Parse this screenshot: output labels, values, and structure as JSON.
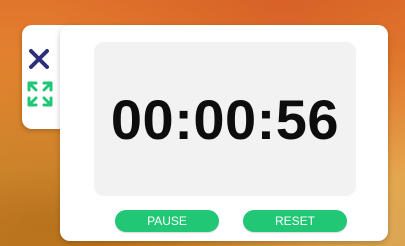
{
  "timer": {
    "display": "00:00:56"
  },
  "controls": {
    "pause_label": "PAUSE",
    "reset_label": "RESET"
  },
  "icons": {
    "close": "close-icon",
    "expand": "expand-icon"
  },
  "colors": {
    "button": "#22c775",
    "close_icon": "#2d2f7a",
    "expand_icon": "#22c775",
    "display_bg": "#f2f2f2",
    "wallpaper": "#e0752c"
  }
}
